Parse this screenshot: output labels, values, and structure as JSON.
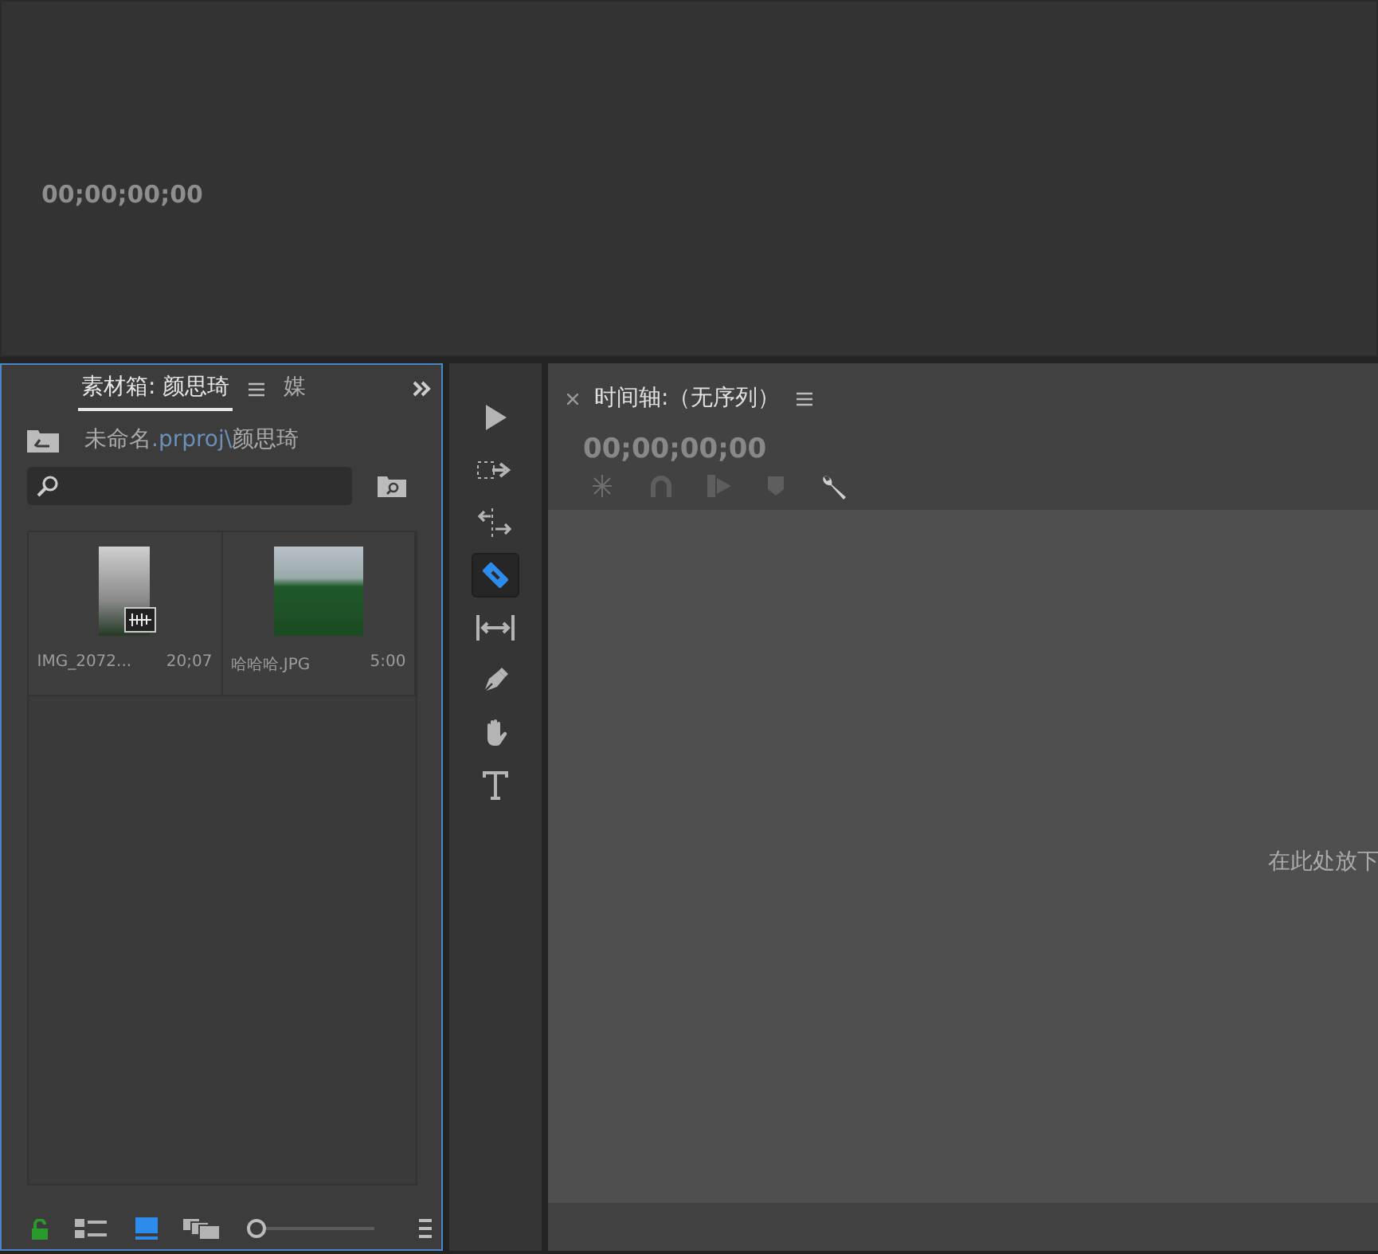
{
  "program_monitor": {
    "timecode": "00;00;00;00"
  },
  "project_panel": {
    "tabs": [
      {
        "label": "素材箱: 颜思琦",
        "selected": true
      },
      {
        "label": "媒",
        "selected": false
      }
    ],
    "path": {
      "project": "未命名",
      "extension": ".prproj\\",
      "bin": "颜思琦"
    },
    "items": [
      {
        "name": "IMG_2072...",
        "duration": "20;07",
        "kind": "video"
      },
      {
        "name": "哈哈哈.JPG",
        "duration": "5:00",
        "kind": "image"
      }
    ],
    "view_buttons": [
      {
        "kind": "list",
        "selected": false
      },
      {
        "kind": "icon",
        "selected": true
      },
      {
        "kind": "freeform",
        "selected": false
      }
    ],
    "zoom_slider": {
      "level": 0.0
    }
  },
  "tools": [
    {
      "kind": "selection",
      "selected": false
    },
    {
      "kind": "track-select",
      "selected": false
    },
    {
      "kind": "ripple",
      "selected": false
    },
    {
      "kind": "razor",
      "selected": true
    },
    {
      "kind": "slip",
      "selected": false
    },
    {
      "kind": "pen",
      "selected": false
    },
    {
      "kind": "hand",
      "selected": false
    },
    {
      "kind": "type",
      "selected": false
    }
  ],
  "timeline": {
    "title": "时间轴:（无序列）",
    "timecode": "00;00;00;00",
    "drop_hint": "在此处放下"
  }
}
